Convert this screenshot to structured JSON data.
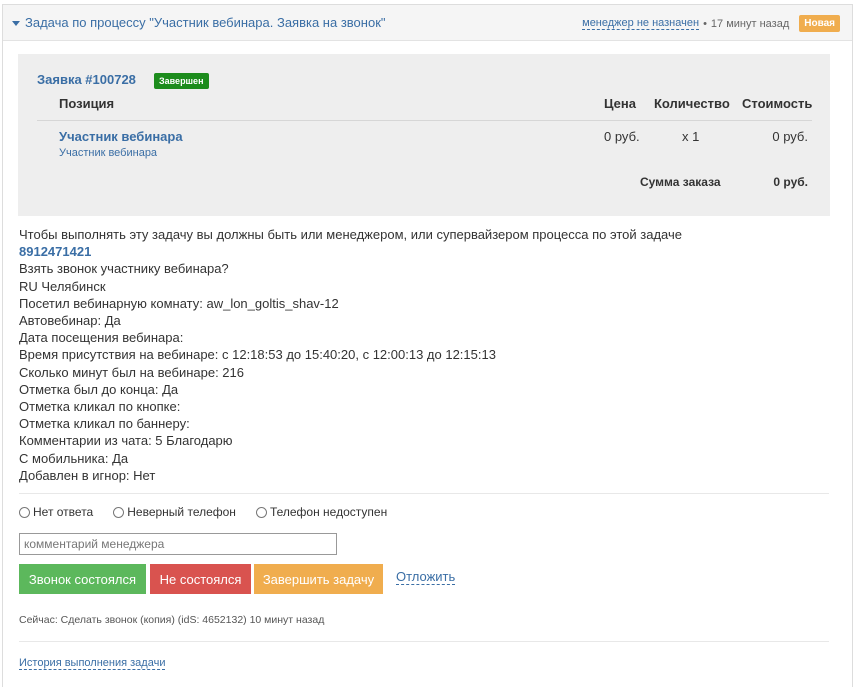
{
  "header": {
    "title": "Задача по процессу \"Участник вебинара. Заявка на звонок\"",
    "manager": "менеджер не назначен",
    "time": "17 минут назад",
    "badge": "Новая"
  },
  "order": {
    "title": "Заявка #100728",
    "status": "Завершен",
    "columns": {
      "position": "Позиция",
      "price": "Цена",
      "quantity": "Количество",
      "cost": "Стоимость"
    },
    "item": {
      "name": "Участник вебинара",
      "sub": "Участник вебинара",
      "price": "0 руб.",
      "quantity": "x 1",
      "cost": "0 руб."
    },
    "sum_label": "Сумма заказа",
    "sum_value": "0 руб."
  },
  "info": {
    "warning": "Чтобы выполнять эту задачу вы должны быть или менеджером, или супервайзером процесса по этой задаче",
    "phone": "8912471421",
    "lines": [
      "Взять звонок участнику вебинара?",
      "RU Челябинск",
      "Посетил вебинарную комнату: aw_lon_goltis_shav-12",
      "Автовебинар: Да",
      "Дата посещения вебинара:",
      "Время присутствия на вебинаре: с 12:18:53 до 15:40:20, с 12:00:13 до 12:15:13",
      "Сколько минут был на вебинаре: 216",
      "Отметка был до конца: Да",
      "Отметка кликал по кнопке:",
      "Отметка кликал по баннеру:",
      "Комментарии из чата: 5 Благодарю",
      "С мобильника: Да",
      "Добавлен в игнор: Нет"
    ]
  },
  "radios": {
    "no_answer": "Нет ответа",
    "wrong_phone": "Неверный телефон",
    "unavailable": "Телефон недоступен"
  },
  "comment": {
    "placeholder": "комментарий менеджера"
  },
  "buttons": {
    "call_done": "Звонок состоялся",
    "not_done": "Не состоялся",
    "finish": "Завершить задачу",
    "postpone": "Отложить"
  },
  "footer": {
    "now": "Сейчас: Сделать звонок (копия) (idS: 4652132) 10 минут назад",
    "history": "История выполнения задачи"
  }
}
